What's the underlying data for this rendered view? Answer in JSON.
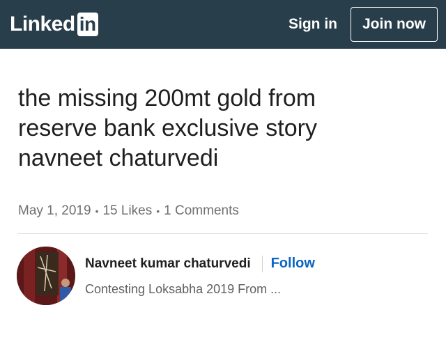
{
  "header": {
    "logo_text": "Linked",
    "logo_badge": "in",
    "sign_in_label": "Sign in",
    "join_label": "Join now"
  },
  "article": {
    "title_lines": [
      "the missing 200mt gold from",
      "reserve bank exclusive story",
      "navneet chaturvedi"
    ],
    "date": "May 1, 2019",
    "likes": "15 Likes",
    "comments": "1 Comments",
    "separator": "•"
  },
  "author": {
    "name": "Navneet kumar chaturvedi",
    "follow_label": "Follow",
    "headline": "Contesting Loksabha 2019 From ..."
  },
  "colors": {
    "topbar": "#283e4a",
    "follow": "#0a66c2"
  }
}
